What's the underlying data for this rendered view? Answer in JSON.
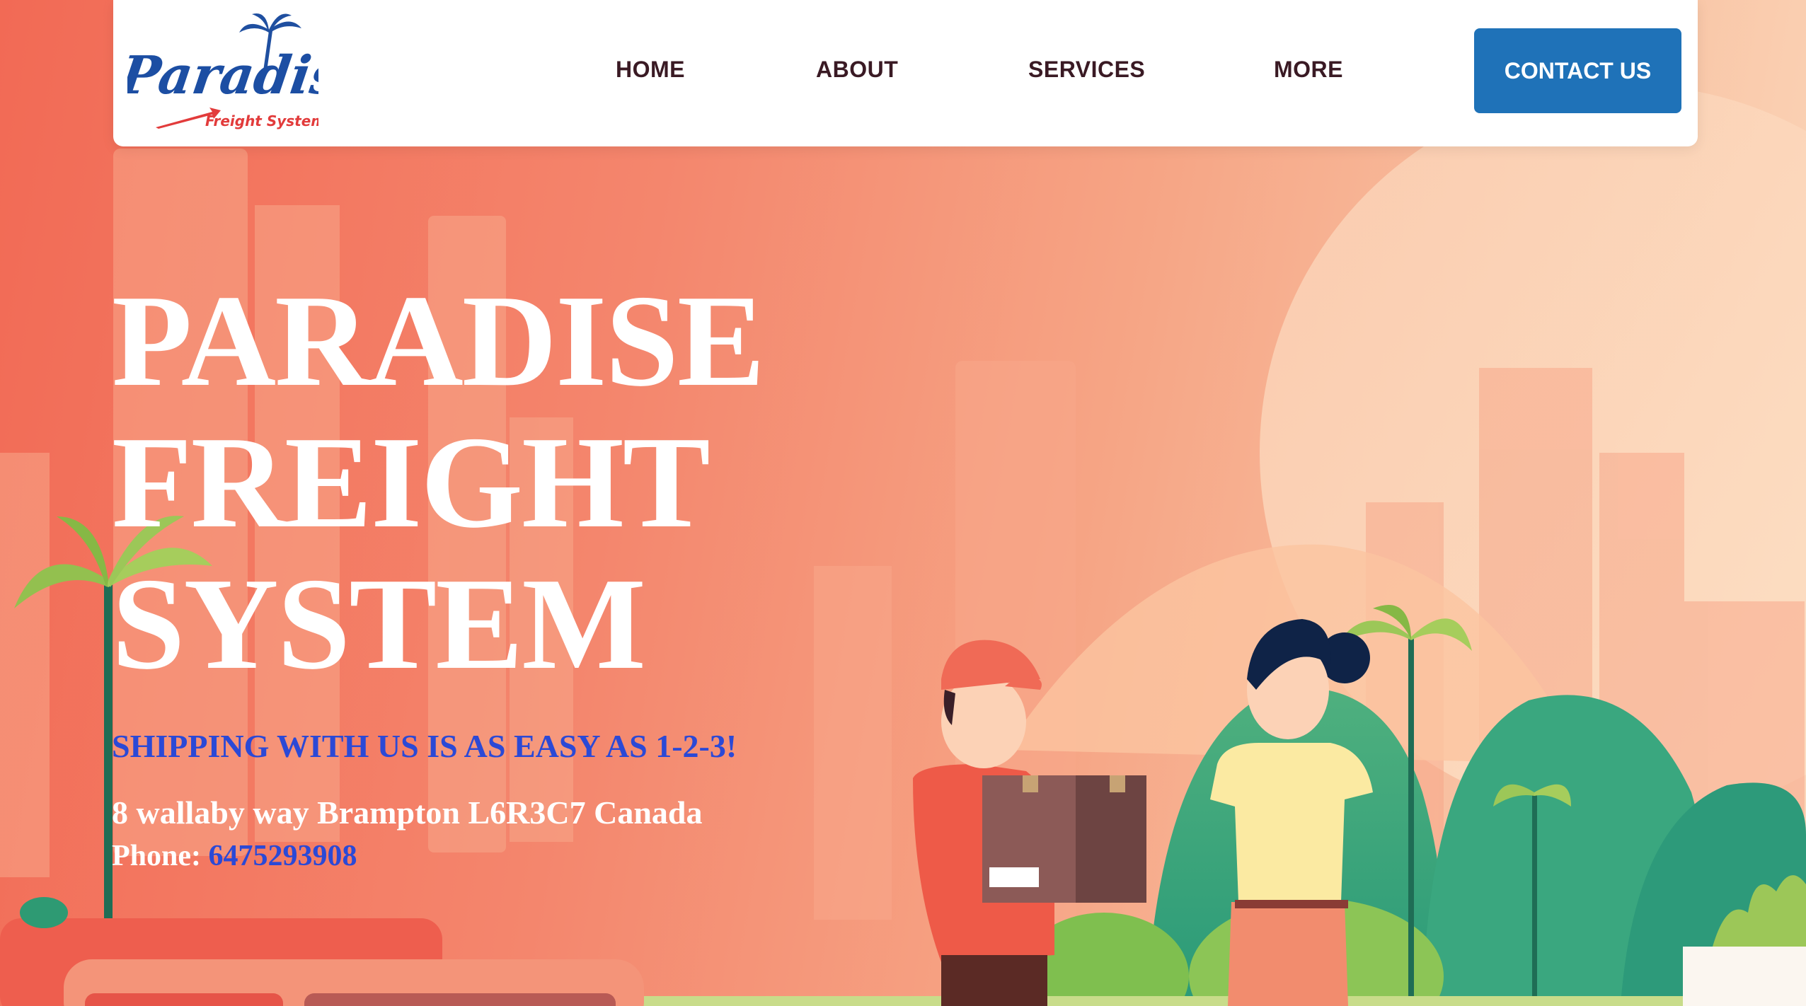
{
  "logo": {
    "wordmark": "Paradise",
    "subtitle": "Freight System"
  },
  "nav": {
    "items": [
      {
        "label": "HOME"
      },
      {
        "label": "ABOUT"
      },
      {
        "label": "SERVICES"
      },
      {
        "label": "MORE"
      }
    ],
    "contact_label": "CONTACT US"
  },
  "hero": {
    "title_lines": [
      "PARADISE",
      "FREIGHT",
      "SYSTEM"
    ],
    "tagline": "SHIPPING WITH US IS AS EASY AS 1-2-3!",
    "address": "8 wallaby way Brampton L6R3C7 Canada",
    "phone_label": "Phone: ",
    "phone_number": "6475293908"
  },
  "colors": {
    "contact_button": "#1f72b8",
    "nav_text": "#3a1a24",
    "tagline": "#2b49d6",
    "hero_text": "#ffffff",
    "background": "#f4866d"
  }
}
